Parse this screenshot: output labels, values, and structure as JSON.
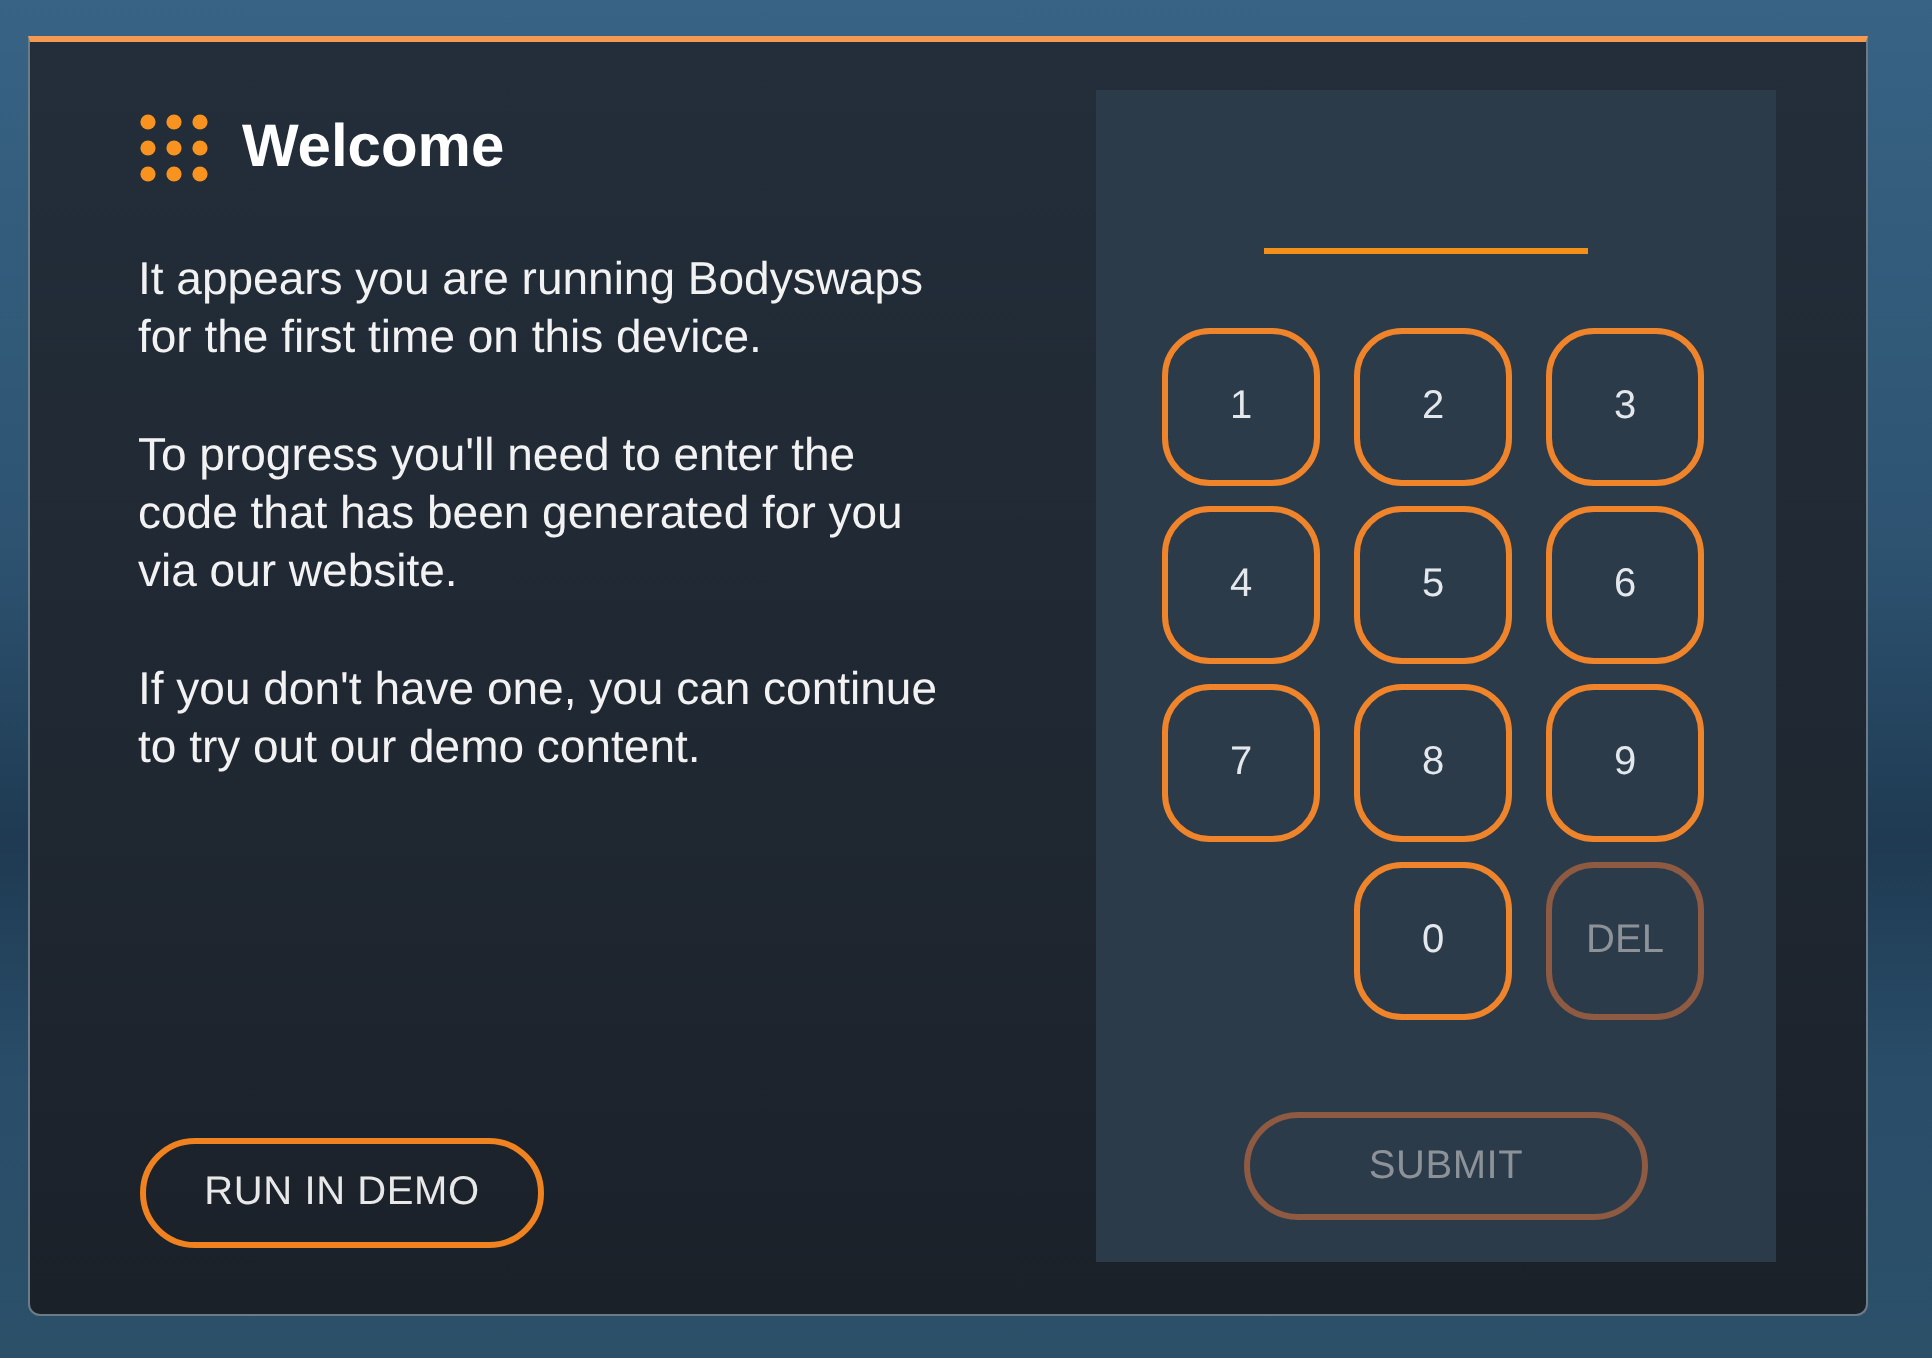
{
  "dialog": {
    "title": "Welcome",
    "paragraphs": [
      "It appears you are running Bodyswaps for the first time on this device.",
      "To progress you'll need to enter the code that has been generated for you via our website.",
      "If you don't have one, you can continue to try out our demo content."
    ],
    "demo_button": {
      "label": "RUN IN DEMO"
    }
  },
  "keypad": {
    "rows": [
      [
        {
          "label": "1",
          "disabled": false
        },
        {
          "label": "2",
          "disabled": false
        },
        {
          "label": "3",
          "disabled": false
        }
      ],
      [
        {
          "label": "4",
          "disabled": false
        },
        {
          "label": "5",
          "disabled": false
        },
        {
          "label": "6",
          "disabled": false
        }
      ],
      [
        {
          "label": "7",
          "disabled": false
        },
        {
          "label": "8",
          "disabled": false
        },
        {
          "label": "9",
          "disabled": false
        }
      ],
      [
        "",
        {
          "label": "0",
          "disabled": false
        },
        {
          "label": "DEL",
          "disabled": true
        }
      ]
    ],
    "submit": {
      "label": "SUBMIT",
      "disabled": true
    }
  }
}
